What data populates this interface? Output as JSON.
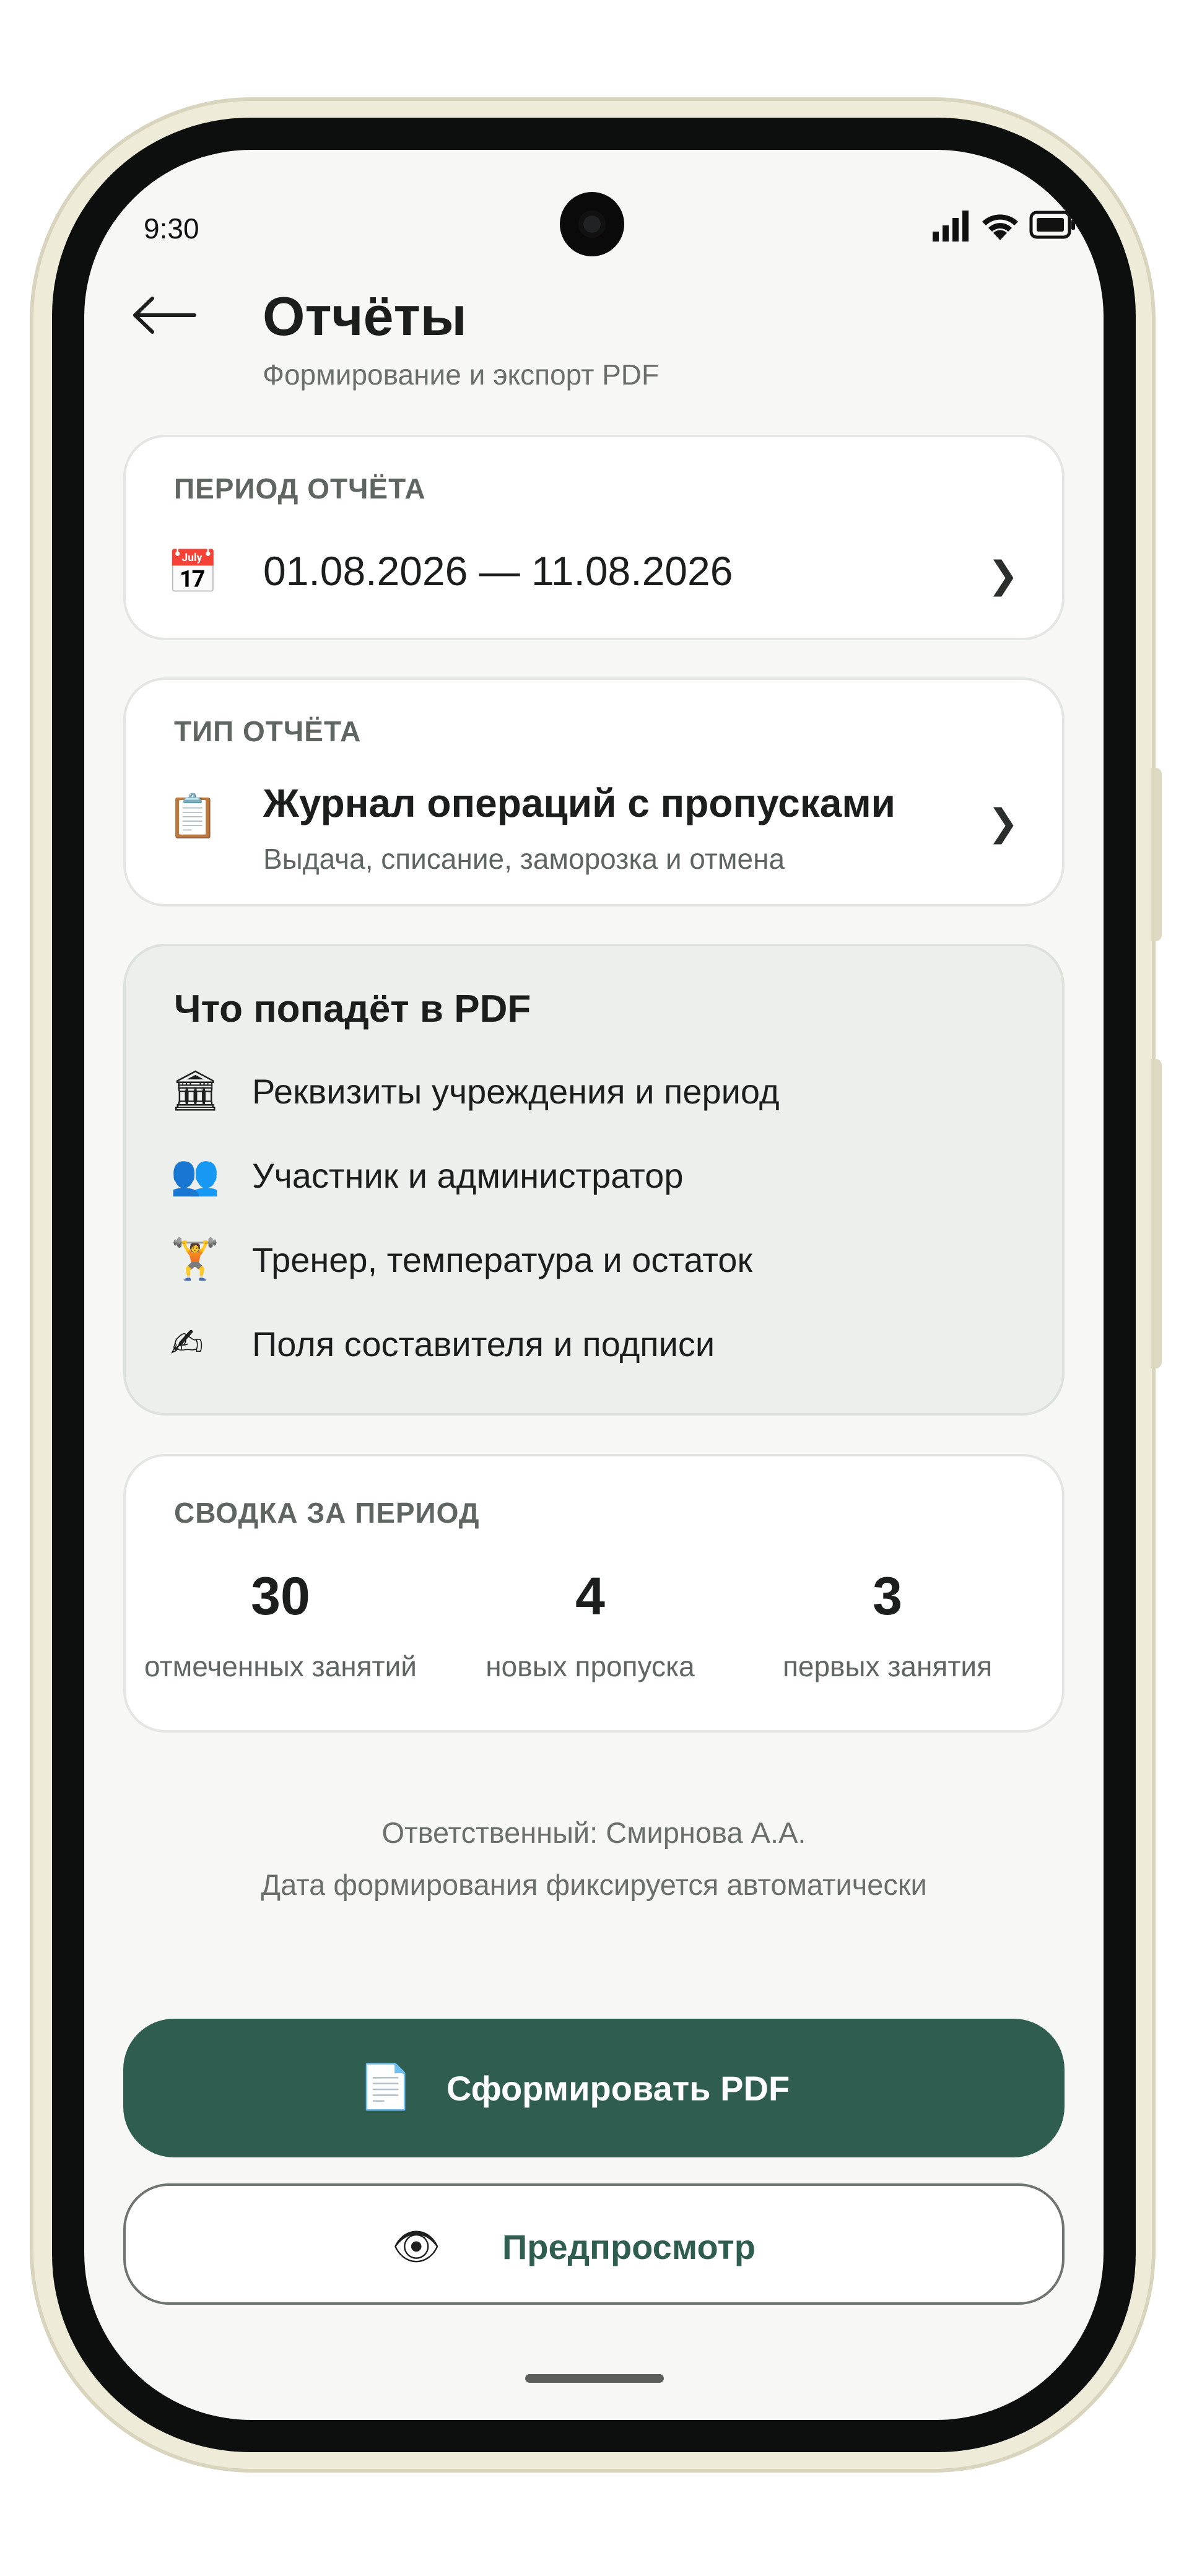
{
  "status_bar": {
    "time": "9:30",
    "icons": [
      "signal-icon",
      "wifi-icon",
      "battery-icon"
    ]
  },
  "header": {
    "back_icon": "arrow-left-icon",
    "title": "Отчёты",
    "subtitle": "Формирование и экспорт PDF"
  },
  "period_card": {
    "label": "ПЕРИОД ОТЧЁТА",
    "icon": "calendar-icon",
    "icon_glyph": "📅",
    "value": "01.08.2026 — 11.08.2026",
    "chevron": "❯"
  },
  "type_card": {
    "label": "ТИП ОТЧЁТА",
    "icon": "clipboard-icon",
    "icon_glyph": "📋",
    "title": "Журнал операций с пропусками",
    "description": "Выдача, списание, заморозка и отмена",
    "chevron": "❯"
  },
  "pdf_contents": {
    "title": "Что попадёт в PDF",
    "items": [
      {
        "icon": "building-icon",
        "glyph": "🏛",
        "text": "Реквизиты учреждения и период"
      },
      {
        "icon": "people-icon",
        "glyph": "👥",
        "text": "Участник и администратор"
      },
      {
        "icon": "trainer-icon",
        "glyph": "🏋",
        "text": "Тренер, температура и остаток"
      },
      {
        "icon": "writing-hand-icon",
        "glyph": "✍",
        "text": "Поля составителя и подписи"
      }
    ]
  },
  "summary": {
    "label": "СВОДКА ЗА ПЕРИОД",
    "stats": [
      {
        "value": "30",
        "label": "отмеченных занятий"
      },
      {
        "value": "4",
        "label": "новых пропуска"
      },
      {
        "value": "3",
        "label": "первых занятия"
      }
    ]
  },
  "footer": {
    "responsible": "Ответственный: Смирнова А.А.",
    "note": "Дата формирования фиксируется автоматически"
  },
  "actions": {
    "generate": {
      "icon": "document-icon",
      "glyph": "📄",
      "label": "Сформировать PDF"
    },
    "preview": {
      "icon": "eye-icon",
      "glyph": "👁",
      "label": "Предпросмотр"
    }
  },
  "colors": {
    "accent": "#2f5e50",
    "screen_background": "#f7f8f6",
    "card_background": "#ffffff",
    "info_card_background": "#ecefeb"
  }
}
